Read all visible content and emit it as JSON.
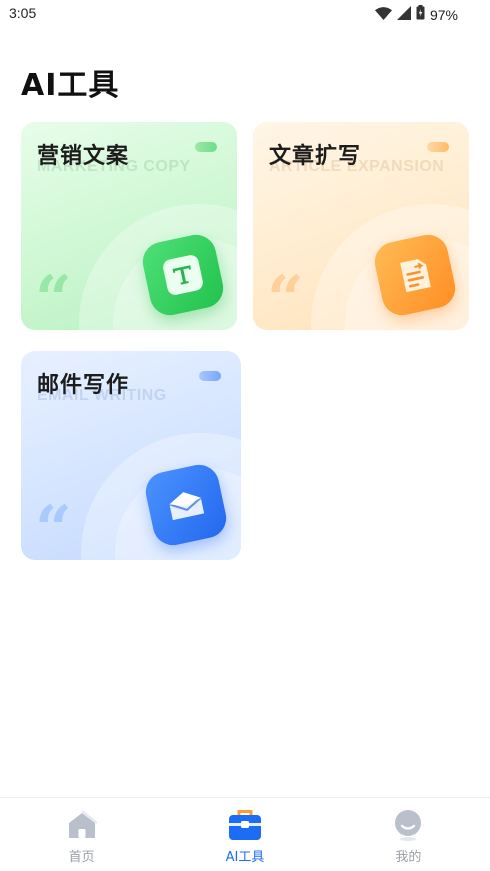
{
  "status_bar": {
    "time": "3:05",
    "battery_percent": "97%",
    "icons": [
      "wifi-icon",
      "signal-icon",
      "battery-icon"
    ]
  },
  "page": {
    "title": "AI工具"
  },
  "tools": [
    {
      "id": "marketing",
      "title": "营销文案",
      "subtitle": "MARKETING COPY",
      "icon": "text-icon",
      "accent": "#2fd45a"
    },
    {
      "id": "article",
      "title": "文章扩写",
      "subtitle": "ARTICLE EXPANSION",
      "icon": "document-expand-icon",
      "accent": "#ff9a2e"
    },
    {
      "id": "email",
      "title": "邮件写作",
      "subtitle": "EMAIL WRITING",
      "icon": "envelope-icon",
      "accent": "#2f7cf6"
    }
  ],
  "bottom_nav": {
    "active": "ai_tools",
    "items": [
      {
        "id": "home",
        "label": "首页",
        "icon": "home-icon"
      },
      {
        "id": "ai_tools",
        "label": "AI工具",
        "icon": "toolbox-icon"
      },
      {
        "id": "mine",
        "label": "我的",
        "icon": "profile-icon"
      }
    ]
  },
  "colors": {
    "active_tab": "#1d6cf5",
    "inactive_tab": "#9aa0a8"
  }
}
